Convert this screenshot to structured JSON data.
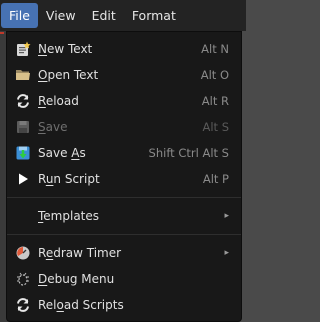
{
  "menubar": {
    "items": [
      {
        "label": "File",
        "active": true
      },
      {
        "label": "View",
        "active": false
      },
      {
        "label": "Edit",
        "active": false
      },
      {
        "label": "Format",
        "active": false
      }
    ]
  },
  "file_menu": {
    "new_text": {
      "first": "N",
      "rest": "ew Text",
      "shortcut": "Alt N",
      "icon": "new-text-icon"
    },
    "open_text": {
      "first": "O",
      "rest": "pen Text",
      "shortcut": "Alt O",
      "icon": "folder-icon"
    },
    "reload": {
      "first": "R",
      "rest": "eload",
      "shortcut": "Alt R",
      "icon": "reload-icon"
    },
    "save": {
      "first": "S",
      "rest": "ave",
      "shortcut": "Alt S",
      "icon": "save-icon",
      "disabled": true
    },
    "save_as": {
      "pre": "Save ",
      "u": "A",
      "post": "s",
      "shortcut": "Shift Ctrl Alt S",
      "icon": "save-as-icon"
    },
    "run_script": {
      "pre": "R",
      "u": "u",
      "post": "n Script",
      "shortcut": "Alt P",
      "icon": "play-icon"
    },
    "templates": {
      "first": "T",
      "rest": "emplates",
      "submenu": "▸"
    },
    "redraw_timer": {
      "pre": "R",
      "u": "e",
      "post": "draw Timer",
      "icon": "timer-icon",
      "submenu": "▸"
    },
    "debug_menu": {
      "first": "D",
      "rest": "ebug Menu",
      "icon": "debug-icon"
    },
    "reload_scripts": {
      "pre": "Rel",
      "u": "o",
      "post": "ad Scripts",
      "icon": "reload-icon"
    }
  },
  "colors": {
    "accent": "#4772b3",
    "menu_bg": "#181818",
    "menubar_bg": "#232323"
  }
}
